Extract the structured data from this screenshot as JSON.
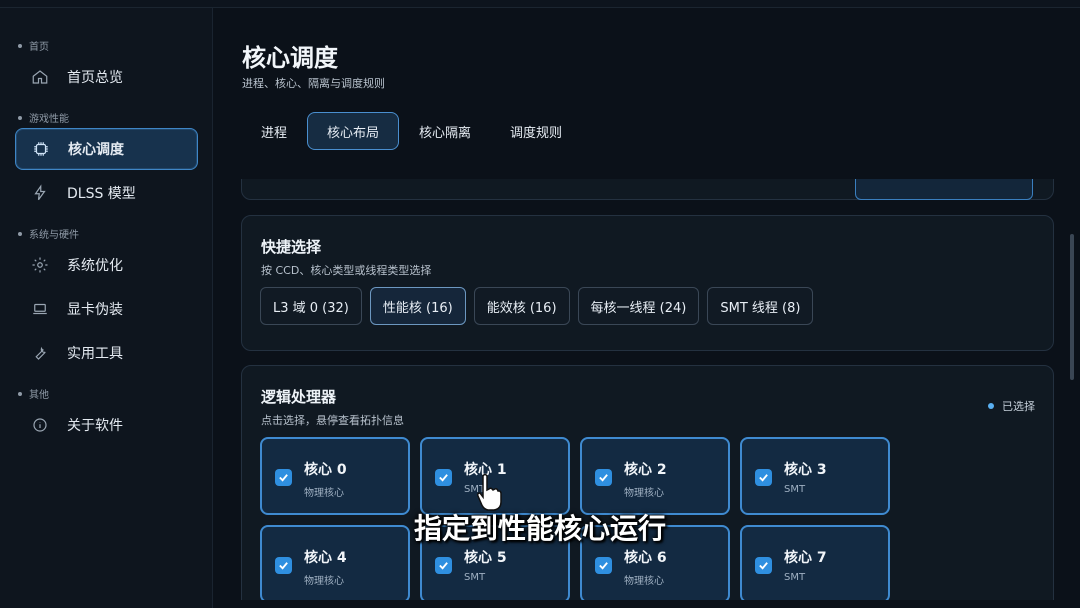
{
  "sidebar": {
    "sections": [
      {
        "label": "首页",
        "items": [
          {
            "label": "首页总览",
            "icon": "home-icon"
          }
        ]
      },
      {
        "label": "游戏性能",
        "items": [
          {
            "label": "核心调度",
            "icon": "cpu-chip-icon",
            "active": true
          },
          {
            "label": "DLSS 模型",
            "icon": "lightning-icon"
          }
        ]
      },
      {
        "label": "系统与硬件",
        "items": [
          {
            "label": "系统优化",
            "icon": "gear-icon"
          },
          {
            "label": "显卡伪装",
            "icon": "laptop-icon"
          },
          {
            "label": "实用工具",
            "icon": "wrench-icon"
          }
        ]
      },
      {
        "label": "其他",
        "items": [
          {
            "label": "关于软件",
            "icon": "info-icon"
          }
        ]
      }
    ]
  },
  "header": {
    "title": "核心调度",
    "subtitle": "进程、核心、隔离与调度规则"
  },
  "tabs": [
    {
      "label": "进程"
    },
    {
      "label": "核心布局",
      "active": true
    },
    {
      "label": "核心隔离"
    },
    {
      "label": "调度规则"
    }
  ],
  "quick_select": {
    "title": "快捷选择",
    "subtitle": "按 CCD、核心类型或线程类型选择",
    "chips": [
      {
        "label": "L3 域 0 (32)"
      },
      {
        "label": "性能核 (16)",
        "active": true
      },
      {
        "label": "能效核 (16)"
      },
      {
        "label": "每核一线程 (24)"
      },
      {
        "label": "SMT 线程 (8)"
      }
    ]
  },
  "logical_processors": {
    "title": "逻辑处理器",
    "subtitle": "点击选择，悬停查看拓扑信息",
    "legend": "已选择",
    "cores": [
      {
        "name": "核心 0",
        "type": "物理核心",
        "checked": true
      },
      {
        "name": "核心 1",
        "type": "SMT",
        "checked": true
      },
      {
        "name": "核心 2",
        "type": "物理核心",
        "checked": true
      },
      {
        "name": "核心 3",
        "type": "SMT",
        "checked": true
      },
      {
        "name": "核心 4",
        "type": "物理核心",
        "checked": true
      },
      {
        "name": "核心 5",
        "type": "SMT",
        "checked": true
      },
      {
        "name": "核心 6",
        "type": "物理核心",
        "checked": true
      },
      {
        "name": "核心 7",
        "type": "SMT",
        "checked": true
      }
    ]
  },
  "overlay_caption": "指定到性能核心运行",
  "colors": {
    "accent": "#3f8ad0",
    "checkbox": "#2f8fe0",
    "background": "#0b1119"
  }
}
